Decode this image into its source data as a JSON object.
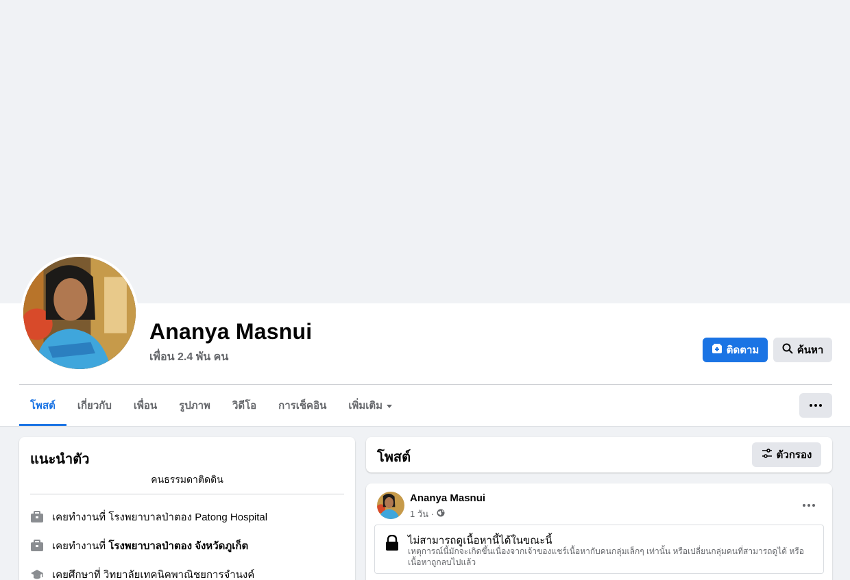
{
  "profile": {
    "name": "Ananya Masnui",
    "friends": "เพื่อน 2.4 พัน คน"
  },
  "actions": {
    "follow_label": "ติดตาม",
    "search_label": "ค้นหา",
    "follow_color": "#1b74e4"
  },
  "tabs": [
    {
      "label": "โพสต์",
      "active": true
    },
    {
      "label": "เกี่ยวกับ"
    },
    {
      "label": "เพื่อน"
    },
    {
      "label": "รูปภาพ"
    },
    {
      "label": "วิดีโอ"
    },
    {
      "label": "การเช็คอิน"
    },
    {
      "label": "เพิ่มเติม"
    }
  ],
  "intro": {
    "title": "แนะนำตัว",
    "bio": "คนธรรมดาติดดิน",
    "items": [
      {
        "icon": "briefcase-icon",
        "prefix": "เคยทำงานที่ ",
        "bold": "",
        "rest": "โรงพยาบาลป่าตอง Patong Hospital"
      },
      {
        "icon": "briefcase-icon",
        "prefix": "เคยทำงานที่ ",
        "bold": "โรงพยาบาลป่าตอง จังหวัดภูเก็ต",
        "rest": ""
      },
      {
        "icon": "graduation-cap-icon",
        "prefix": "เคยศึกษาที่ ",
        "bold": "",
        "rest": "วิทยาลัยเทคนิคพาณิชยการจำนงค์"
      }
    ]
  },
  "posts": {
    "title": "โพสต์",
    "filter_label": "ตัวกรอง",
    "items": [
      {
        "author": "Ananya Masnui",
        "time": "1 วัน ·",
        "privacy_icon": "globe-icon",
        "unavailable_title": "ไม่สามารถดูเนื้อหานี้ได้ในขณะนี้",
        "unavailable_desc": "เหตุการณ์นี้มักจะเกิดขึ้นเนื่องจากเจ้าของแชร์เนื้อหากับคนกลุ่มเล็กๆ เท่านั้น หรือเปลี่ยนกลุ่มคนที่สามารถดูได้ หรือเนื้อหาถูกลบไปแล้ว"
      }
    ]
  }
}
